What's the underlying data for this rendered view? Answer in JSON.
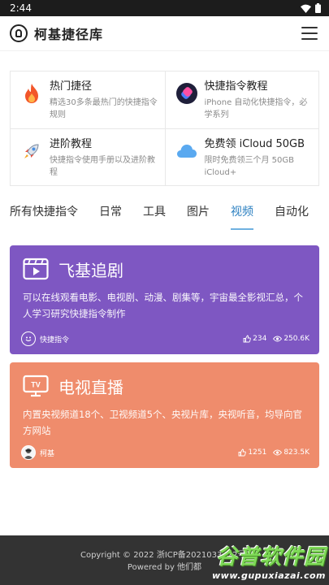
{
  "status": {
    "time": "2:44"
  },
  "app": {
    "title": "柯基捷径库"
  },
  "grid": [
    {
      "title": "热门捷径",
      "desc": "精选30多条最热门的快捷指令规则",
      "icon": "fire-icon"
    },
    {
      "title": "快捷指令教程",
      "desc": "iPhone 自动化快捷指令，必学系列",
      "icon": "shortcuts-app-icon"
    },
    {
      "title": "进阶教程",
      "desc": "快捷指令使用手册以及进阶教程",
      "icon": "rocket-icon"
    },
    {
      "title": "免费领 iCloud 50GB",
      "desc": "限时免费领三个月 50GB iCloud+",
      "icon": "icloud-icon"
    }
  ],
  "tabs": [
    "所有快捷指令",
    "日常",
    "工具",
    "图片",
    "视频",
    "自动化"
  ],
  "active_tab": "视频",
  "cards": [
    {
      "title": "飞基追剧",
      "desc": "可以在线观看电影、电视剧、动漫、剧集等，宇宙最全影视汇总，个人学习研究快捷指令制作",
      "author": "快捷指令",
      "likes": "234",
      "views": "250.6K",
      "color": "#7e57c2",
      "icon": "video-player-icon"
    },
    {
      "title": "电视直播",
      "desc": "内置央视频道18个、卫视频道5个、央视片库，央视听音，均导向官方网站",
      "author": "柯基",
      "likes": "1251",
      "views": "823.5K",
      "color": "#ef8c6c",
      "icon": "tv-icon"
    }
  ],
  "footer": {
    "line1": "Copyright © 2022 浙ICP备2021033972号-",
    "line2": "Powered by 他们都"
  },
  "watermark": {
    "main": "谷普软件园",
    "url": "www.gupuxiazai.com"
  }
}
